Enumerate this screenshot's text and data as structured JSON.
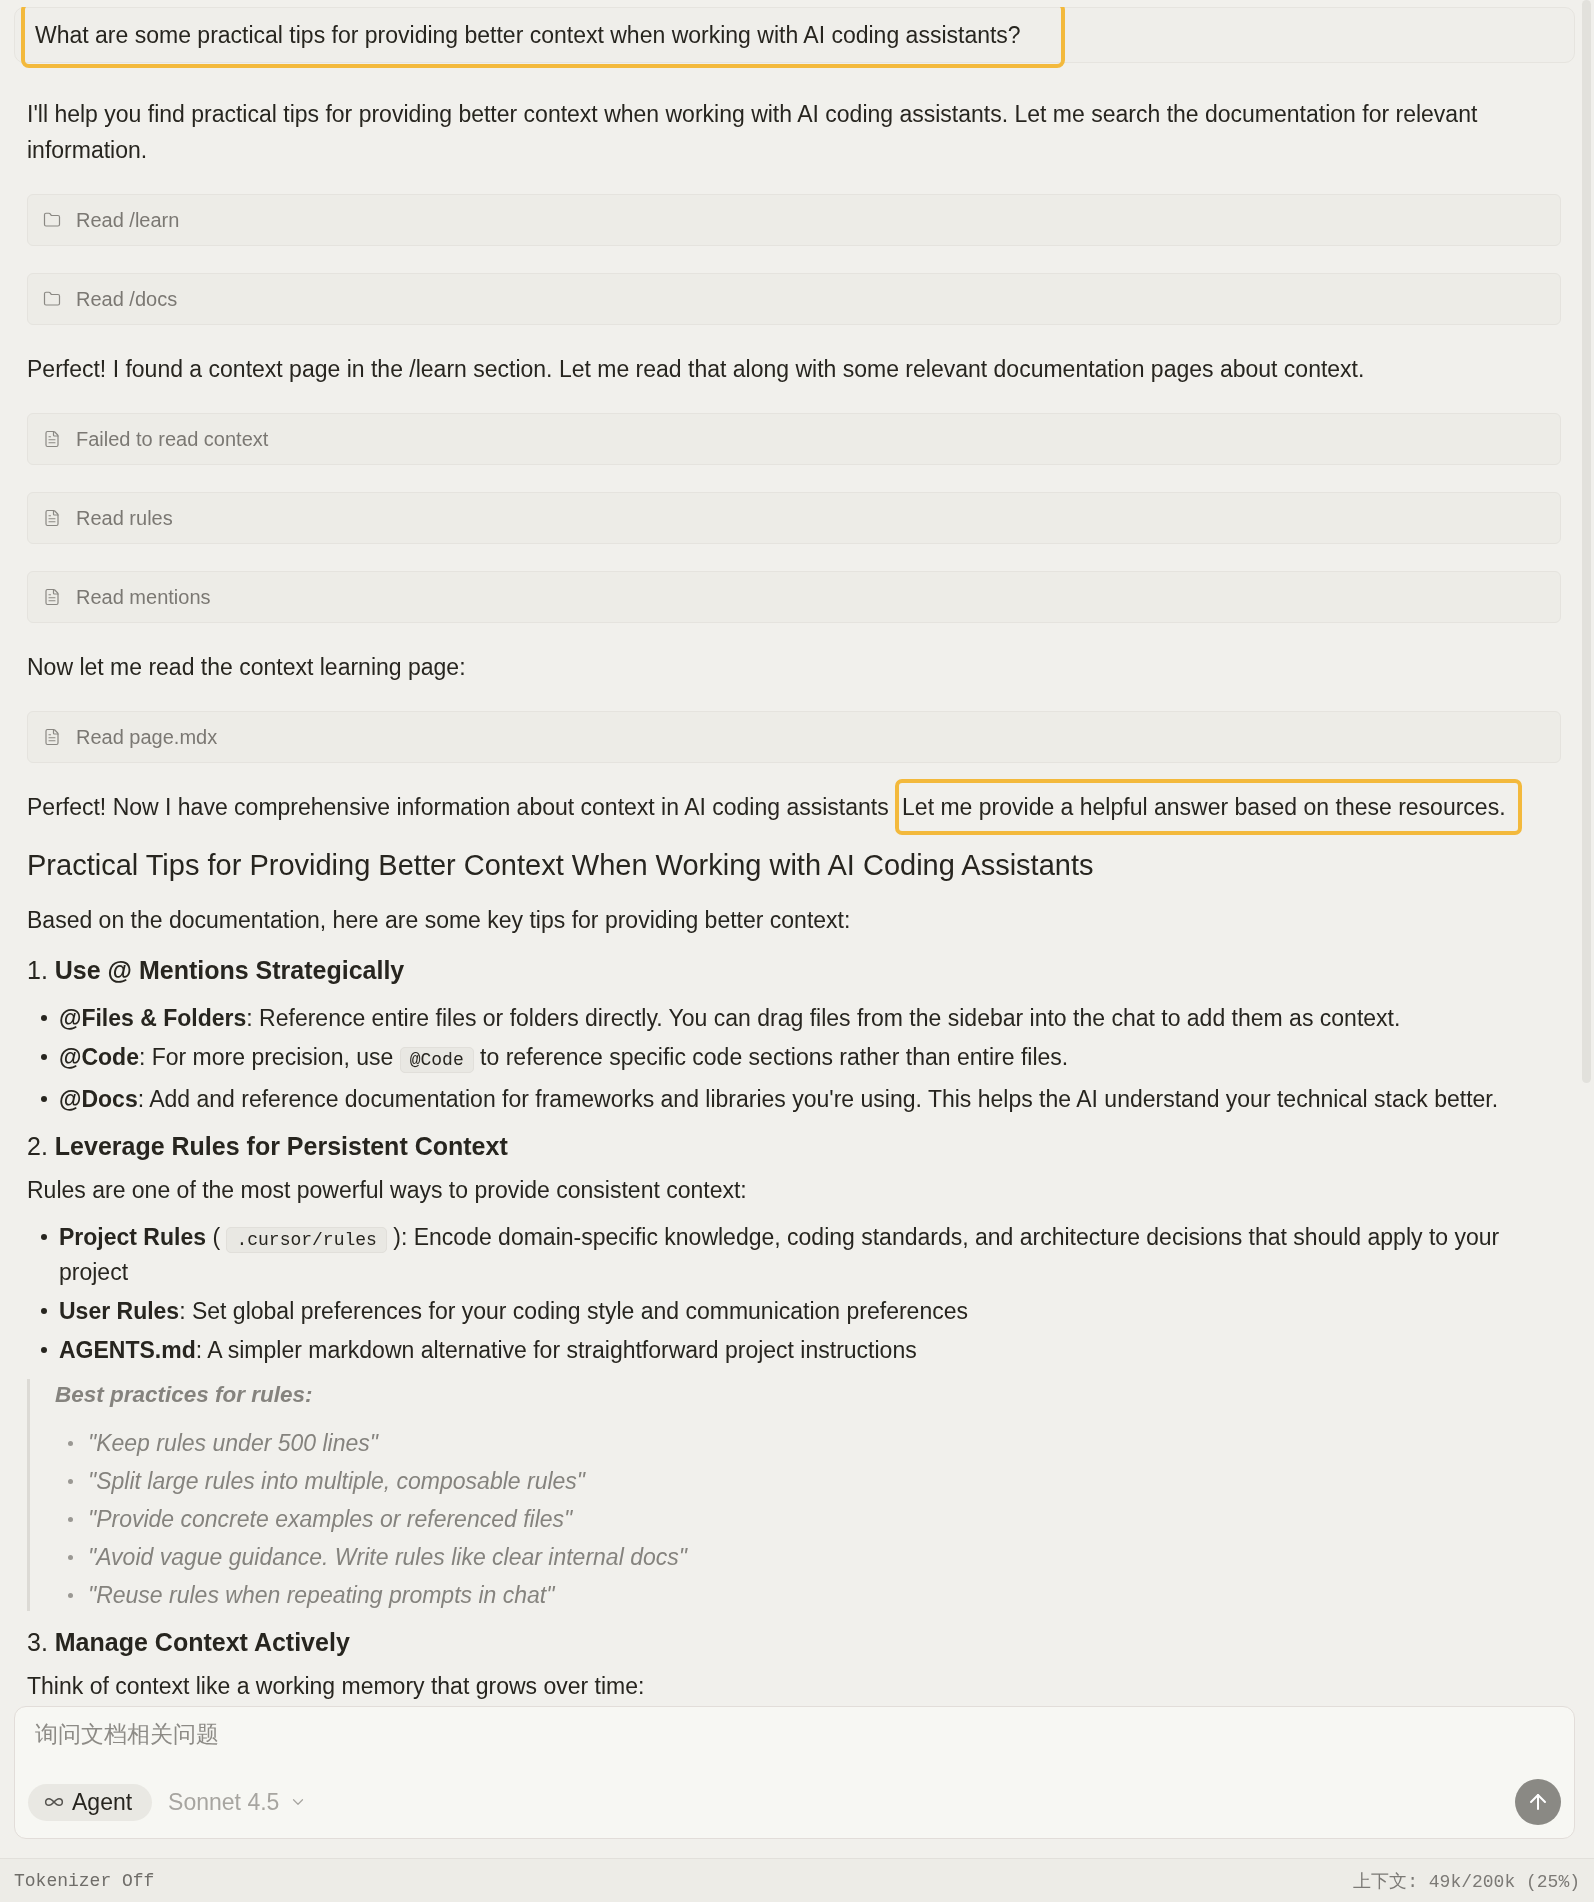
{
  "user_message": {
    "text": "What are some practical tips for providing better context when working with AI coding assistants?",
    "highlighted": true
  },
  "conversation": [
    {
      "kind": "paragraph",
      "segments": [
        {
          "text": "I'll help you find practical tips for providing better context when working with AI coding assistants. Let me search the documentation for relevant information.",
          "highlighted": false
        }
      ]
    },
    {
      "kind": "folder_call",
      "label": "Read /learn"
    },
    {
      "kind": "folder_call",
      "label": "Read /docs"
    },
    {
      "kind": "paragraph",
      "segments": [
        {
          "text": "Perfect! I found a context page in the /learn section. Let me read that along with some relevant documentation pages about context.",
          "highlighted": false
        }
      ]
    },
    {
      "kind": "file_call",
      "label": "Failed to read context"
    },
    {
      "kind": "file_call",
      "label": "Read rules"
    },
    {
      "kind": "file_call",
      "label": "Read mentions"
    },
    {
      "kind": "paragraph",
      "segments": [
        {
          "text": "Now let me read the context learning page:",
          "highlighted": false
        }
      ]
    },
    {
      "kind": "file_call",
      "label": "Read page.mdx"
    },
    {
      "kind": "paragraph",
      "segments": [
        {
          "text": "Perfect! Now I have comprehensive information about context in AI coding assistants ",
          "highlighted": false
        },
        {
          "text": "Let me provide a helpful answer based on these resources.",
          "highlighted": true
        }
      ]
    },
    {
      "kind": "heading",
      "text": "Practical Tips for Providing Better Context When Working with AI Coding Assistants"
    },
    {
      "kind": "paragraph",
      "segments": [
        {
          "text": "Based on the documentation, here are some key tips for providing better context:",
          "highlighted": false
        }
      ]
    },
    {
      "kind": "section",
      "text": "1. **Use @ Mentions Strategically**"
    },
    {
      "kind": "list",
      "items": [
        {
          "segments": [
            {
              "kind": "text",
              "text": "**@Files & Folders**: Reference entire files or folders directly. You can drag files from the sidebar into the chat to add them as context."
            }
          ]
        },
        {
          "segments": [
            {
              "kind": "text",
              "text": "**@Code**: For more precision, use "
            },
            {
              "kind": "code",
              "text": "@Code"
            },
            {
              "kind": "text",
              "text": " to reference specific code sections rather than entire files."
            }
          ]
        },
        {
          "segments": [
            {
              "kind": "text",
              "text": "**@Docs**: Add and reference documentation for frameworks and libraries you're using. This helps the AI understand your technical stack better."
            }
          ]
        }
      ]
    },
    {
      "kind": "section",
      "text": "2. **Leverage Rules for Persistent Context**"
    },
    {
      "kind": "paragraph",
      "segments": [
        {
          "text": "Rules are one of the most powerful ways to provide consistent context:",
          "highlighted": false
        }
      ]
    },
    {
      "kind": "list",
      "items": [
        {
          "segments": [
            {
              "kind": "text",
              "text": "**Project Rules** ( "
            },
            {
              "kind": "code",
              "text": ".cursor/rules"
            },
            {
              "kind": "text",
              "text": " ): Encode domain-specific knowledge, coding standards, and architecture decisions that should apply to your project"
            }
          ]
        },
        {
          "segments": [
            {
              "kind": "text",
              "text": "**User Rules**: Set global preferences for your coding style and communication preferences"
            }
          ]
        },
        {
          "segments": [
            {
              "kind": "text",
              "text": "**AGENTS.md**: A simpler markdown alternative for straightforward project instructions"
            }
          ]
        }
      ]
    },
    {
      "kind": "quote",
      "title": "Best practices for rules:",
      "items": [
        "\"Keep rules under 500 lines\"",
        "\"Split large rules into multiple, composable rules\"",
        "\"Provide concrete examples or referenced files\"",
        "\"Avoid vague guidance. Write rules like clear internal docs\"",
        "\"Reuse rules when repeating prompts in chat\""
      ]
    },
    {
      "kind": "section",
      "text": "3. **Manage Context Actively**"
    },
    {
      "kind": "paragraph",
      "segments": [
        {
          "text": "Think of context like a working memory that grows over time:",
          "highlighted": false
        }
      ]
    }
  ],
  "composer": {
    "placeholder": "询问文档相关问题",
    "mode": "Agent",
    "model": "Sonnet 4.5"
  },
  "status_bar": {
    "left": "Tokenizer Off",
    "right": "上下文: 49k/200k (25%)"
  }
}
